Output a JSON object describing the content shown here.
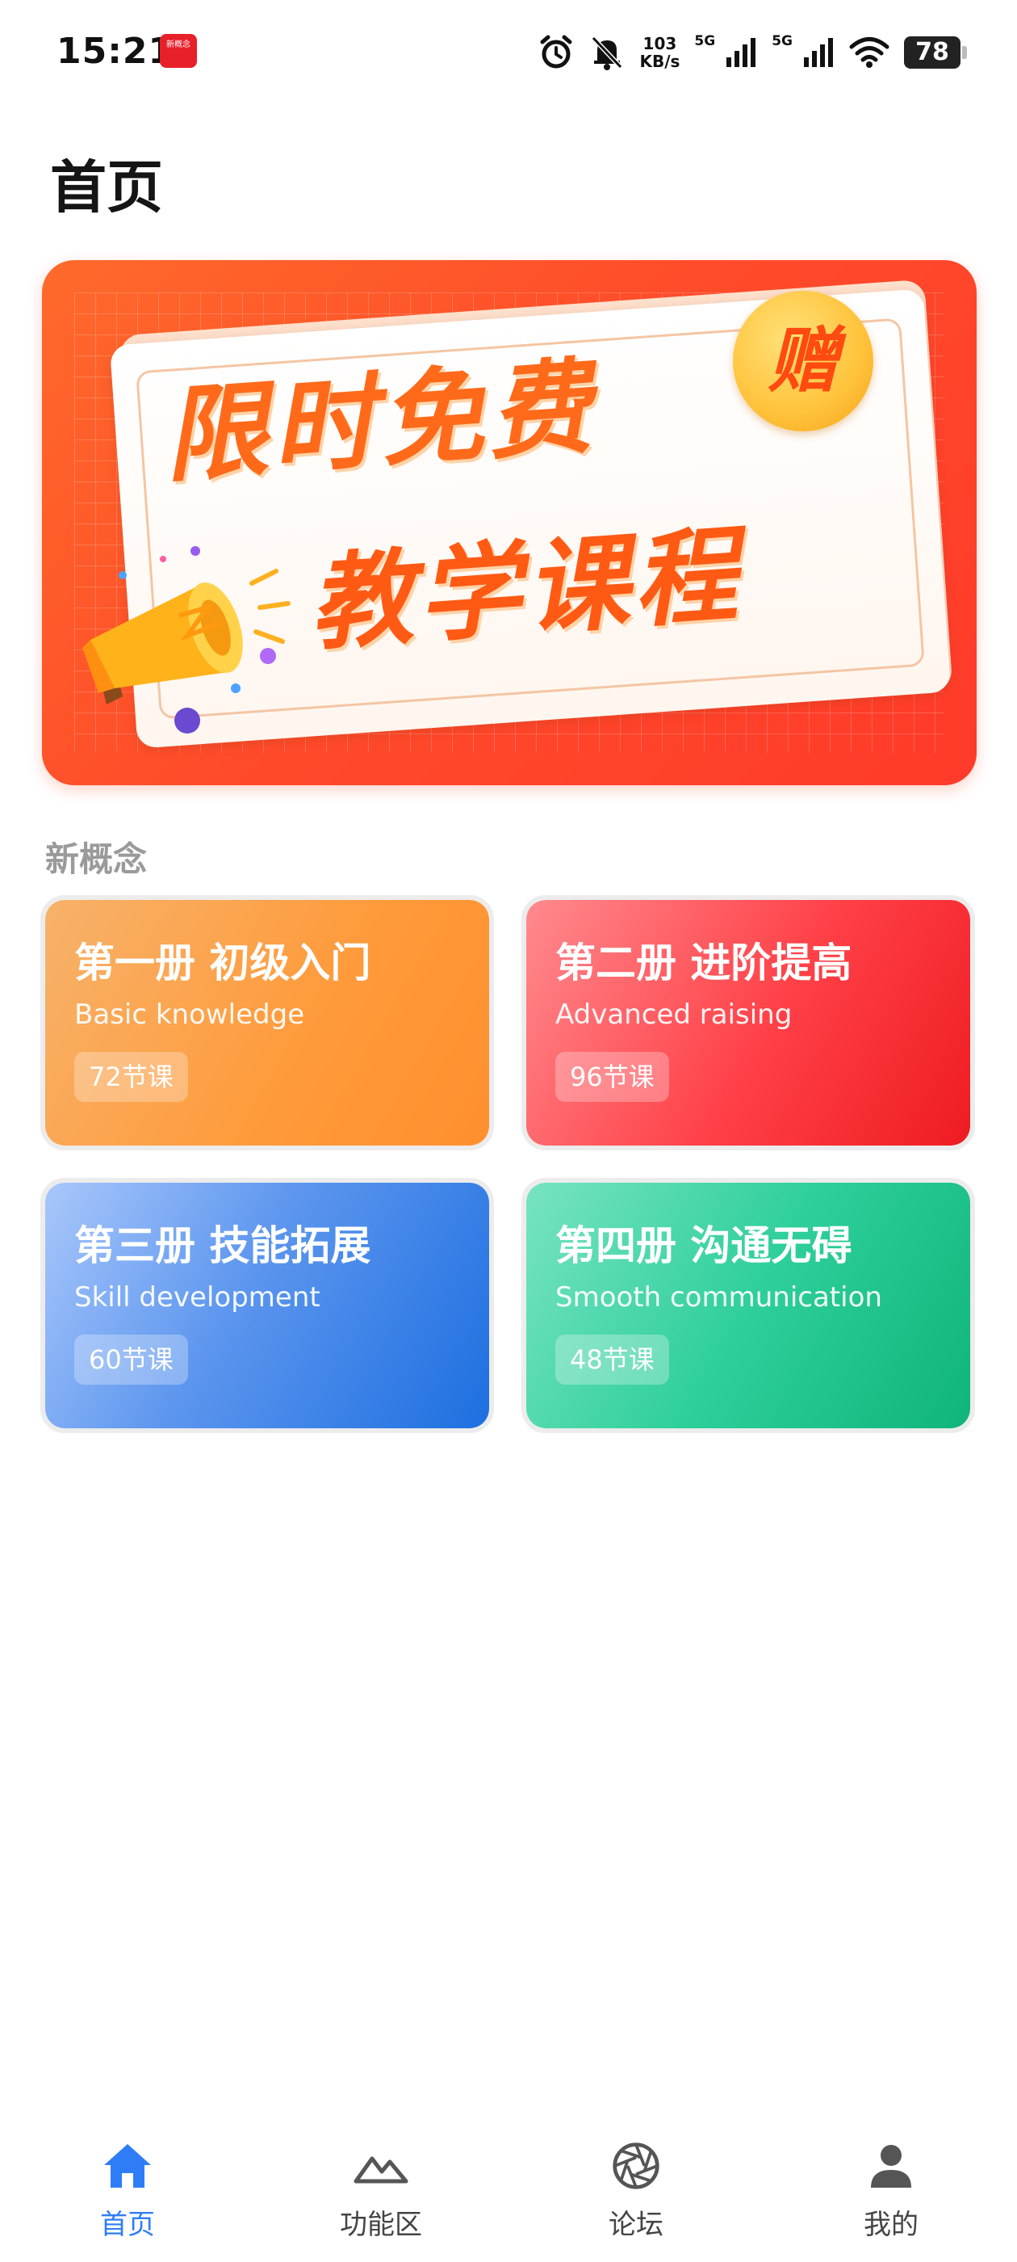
{
  "status_bar": {
    "time": "15:21",
    "net_speed_value": "103",
    "net_speed_unit": "KB/s",
    "sim1_label": "5G",
    "sim2_label": "5G",
    "battery": "78",
    "notification_app_text": "新概念"
  },
  "page": {
    "title": "首页"
  },
  "banner": {
    "line1": "限时免费",
    "line2": "教学课程",
    "badge": "赠"
  },
  "section": {
    "label": "新概念"
  },
  "courses": [
    {
      "title": "第一册 初级入门",
      "subtitle": "Basic knowledge",
      "lessons": "72节课",
      "color": "#ff9a3a"
    },
    {
      "title": "第二册 进阶提高",
      "subtitle": "Advanced raising",
      "lessons": "96节课",
      "color": "#ff3f46"
    },
    {
      "title": "第三册 技能拓展",
      "subtitle": "Skill development",
      "lessons": "60节课",
      "color": "#1d6fe0"
    },
    {
      "title": "第四册 沟通无碍",
      "subtitle": "Smooth communication",
      "lessons": "48节课",
      "color": "#0fb579"
    }
  ],
  "nav": {
    "items": [
      {
        "label": "首页",
        "icon": "home-icon",
        "active": true
      },
      {
        "label": "功能区",
        "icon": "mountain-icon",
        "active": false
      },
      {
        "label": "论坛",
        "icon": "aperture-icon",
        "active": false
      },
      {
        "label": "我的",
        "icon": "person-icon",
        "active": false
      }
    ],
    "active_color": "#2f7df6",
    "inactive_color": "#555555"
  }
}
